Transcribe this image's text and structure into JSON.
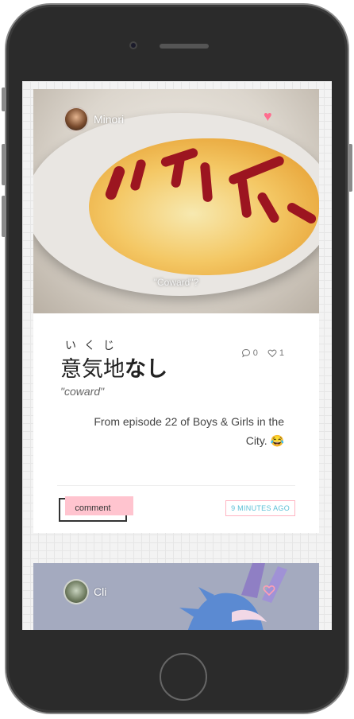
{
  "posts": [
    {
      "author": "Minori",
      "photo_caption": "\"Coward\"?",
      "furigana": "いくじ",
      "word_kanji": "意気地",
      "word_kana": "なし",
      "romaji": "\"coward\"",
      "comment_count": "0",
      "like_count": "1",
      "description": "From episode 22 of Boys & Girls in the City. 😂",
      "comment_label": "comment",
      "time_label": "9 MINUTES AGO",
      "liked": true
    },
    {
      "author": "Cli"
    }
  ],
  "icons": {
    "like": "heart-icon",
    "comment": "speech-bubble-icon",
    "like_count": "heart-outline-icon"
  },
  "colors": {
    "accent_pink": "#ff6d8f",
    "button_fill": "#ffc4cf",
    "time_text": "#5ac0d6"
  }
}
